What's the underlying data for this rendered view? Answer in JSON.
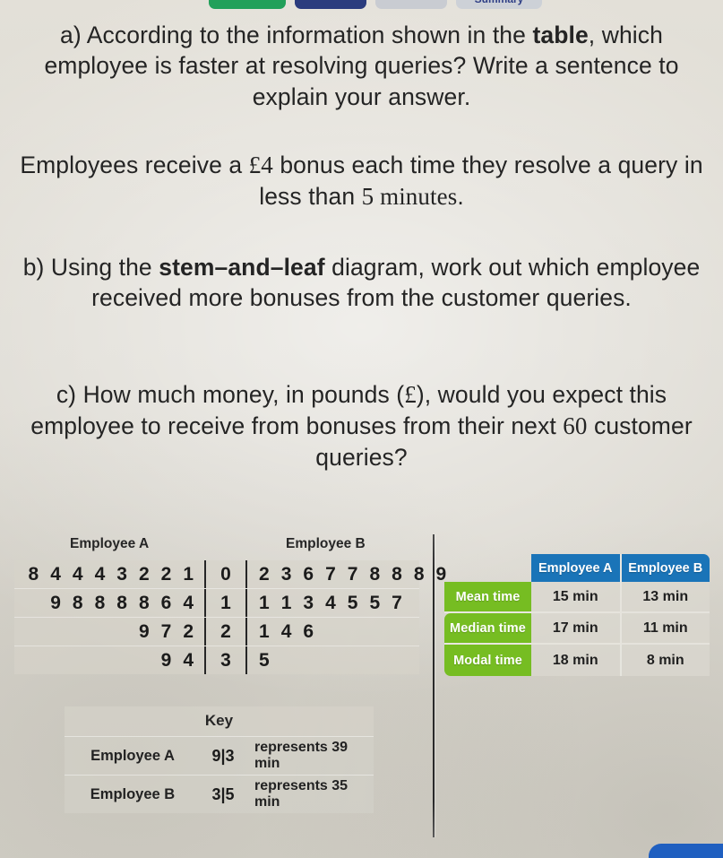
{
  "toolbar": {
    "green_label": "",
    "navy_label": "",
    "grey_label": "",
    "summary_label": "Summary"
  },
  "questions": [
    {
      "id": "part-a",
      "lead": "a)",
      "segments": [
        {
          "text": "a) According to the information shown in the ",
          "style": "normal"
        },
        {
          "text": "table",
          "style": "bold"
        },
        {
          "text": ", which employee is faster at resolving queries? Write a sentence to explain your answer.",
          "style": "normal"
        }
      ]
    },
    {
      "id": "bonus-statement",
      "segments": [
        {
          "text": "Employees receive a ",
          "style": "normal"
        },
        {
          "text": "£4",
          "style": "serif"
        },
        {
          "text": " bonus each time they resolve a query in less than ",
          "style": "normal"
        },
        {
          "text": "5 minutes",
          "style": "serif"
        },
        {
          "text": ".",
          "style": "normal"
        }
      ]
    },
    {
      "id": "part-b",
      "lead": "b)",
      "segments": [
        {
          "text": "b) Using the ",
          "style": "normal"
        },
        {
          "text": "stem–and–leaf",
          "style": "bold"
        },
        {
          "text": " diagram, work out which employee received more bonuses from the customer queries.",
          "style": "normal"
        }
      ]
    },
    {
      "id": "part-c",
      "lead": "c)",
      "segments": [
        {
          "text": "c) How much money, in pounds (",
          "style": "normal"
        },
        {
          "text": "£",
          "style": "serif"
        },
        {
          "text": "), would you expect this employee to receive from bonuses from their next ",
          "style": "normal"
        },
        {
          "text": "60",
          "style": "serif"
        },
        {
          "text": " customer queries?",
          "style": "normal"
        }
      ]
    }
  ],
  "stem_and_leaf": {
    "left_title": "Employee A",
    "right_title": "Employee B",
    "rows": [
      {
        "left": [
          "8",
          "4",
          "4",
          "4",
          "3",
          "2",
          "2",
          "1"
        ],
        "stem": "0",
        "right": [
          "2",
          "3",
          "6",
          "7",
          "7",
          "8",
          "8",
          "8",
          "9"
        ]
      },
      {
        "left": [
          "9",
          "8",
          "8",
          "8",
          "8",
          "6",
          "4"
        ],
        "stem": "1",
        "right": [
          "1",
          "1",
          "3",
          "4",
          "5",
          "5",
          "7"
        ]
      },
      {
        "left": [
          "9",
          "7",
          "2"
        ],
        "stem": "2",
        "right": [
          "1",
          "4",
          "6"
        ]
      },
      {
        "left": [
          "9",
          "4"
        ],
        "stem": "3",
        "right": [
          "5"
        ]
      }
    ]
  },
  "key": {
    "title": "Key",
    "rows": [
      {
        "name": "Employee A",
        "code": "9|3",
        "represents": "represents 39 min"
      },
      {
        "name": "Employee B",
        "code": "3|5",
        "represents": "represents 35 min"
      }
    ]
  },
  "summary_table": {
    "columns": [
      "Employee A",
      "Employee B"
    ],
    "rows": [
      {
        "label": "Mean time",
        "values": [
          "15 min",
          "13 min"
        ]
      },
      {
        "label": "Median time",
        "values": [
          "17 min",
          "11 min"
        ]
      },
      {
        "label": "Modal time",
        "values": [
          "18 min",
          "8 min"
        ]
      }
    ]
  },
  "colors": {
    "background": "#dedbd3",
    "table_header_blue": "#1a74b8",
    "table_label_green": "#76bd22",
    "toolbar_green": "#22a05a",
    "toolbar_navy": "#2b3c7e",
    "summary_blue_text": "#2f3f86",
    "bottom_nub_blue": "#1f5fc0",
    "text": "#242424"
  }
}
